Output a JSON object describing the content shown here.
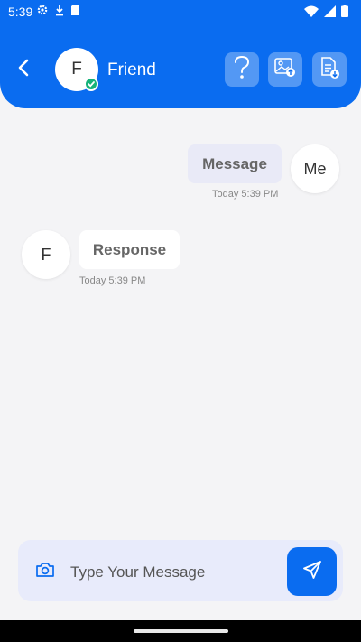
{
  "status_bar": {
    "time": "5:39",
    "left_icons": [
      "settings-icon",
      "download-icon",
      "sd-card-icon"
    ],
    "right_icons": [
      "wifi-icon",
      "signal-icon",
      "battery-icon"
    ]
  },
  "header": {
    "back_icon": "back-arrow-icon",
    "avatar_initial": "F",
    "contact_name": "Friend",
    "verified_icon": "shield-check-icon",
    "actions": [
      "help-icon",
      "image-upload-icon",
      "document-upload-icon"
    ]
  },
  "messages": [
    {
      "sender": "me",
      "avatar_label": "Me",
      "text": "Message",
      "timestamp": "Today 5:39 PM"
    },
    {
      "sender": "friend",
      "avatar_label": "F",
      "text": "Response",
      "timestamp": "Today 5:39 PM"
    }
  ],
  "composer": {
    "placeholder": "Type Your Message",
    "value": "",
    "camera_icon": "camera-icon",
    "send_icon": "send-icon"
  },
  "colors": {
    "primary": "#0a6cf0",
    "background": "#f4f4f6",
    "sent_bubble": "#e9eaf7",
    "received_bubble": "#ffffff",
    "verified": "#16b27a",
    "composer_bg": "#e8ebfb"
  }
}
